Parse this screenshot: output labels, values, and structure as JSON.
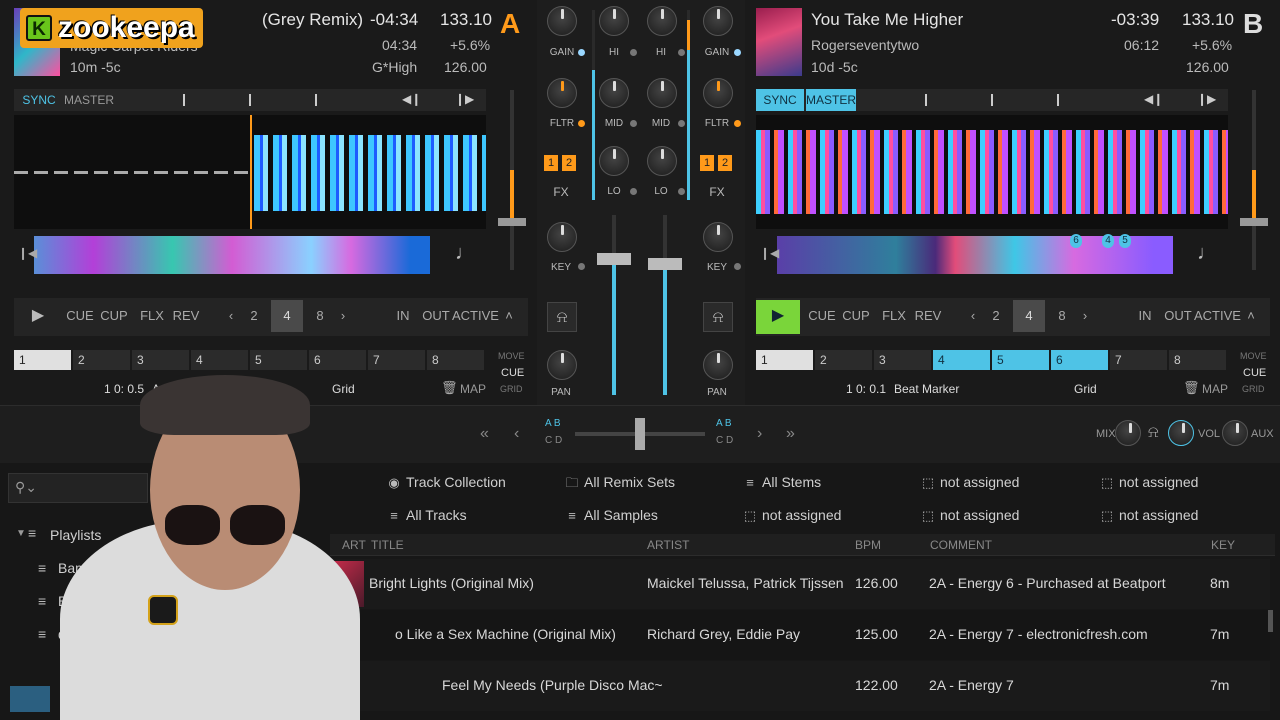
{
  "overlay": {
    "brand_letter": "K",
    "brand_name": "zookeepa"
  },
  "deckA": {
    "letter": "A",
    "title": "(Grey Remix)",
    "artist": "Magic Carpet Riders",
    "time_remaining": "-04:34",
    "time_total": "04:34",
    "bpm": "133.10",
    "pitch": "+5.6%",
    "info": "10m -5c",
    "key": "G*High",
    "base_bpm": "126.00",
    "sync": "SYNC",
    "master": "MASTER",
    "transport": {
      "cue": "CUE",
      "cup": "CUP",
      "flx": "FLX",
      "rev": "REV",
      "in": "IN",
      "out": "OUT",
      "active": "ACTIVE"
    },
    "loop_sizes": [
      "2",
      "4",
      "8"
    ],
    "hotcues": [
      "1",
      "2",
      "3",
      "4",
      "5",
      "6",
      "7",
      "8"
    ],
    "move_label": "MOVE",
    "move_mode": "CUE",
    "grid_label": "GRID",
    "beat_pos": "1 0: 0.5",
    "grid_mode": "AutoGri",
    "grid": "Grid",
    "map": "MAP"
  },
  "deckB": {
    "letter": "B",
    "title": "You Take Me Higher",
    "artist": "Rogerseventytwo",
    "time_remaining": "-03:39",
    "time_total": "06:12",
    "bpm": "133.10",
    "pitch": "+5.6%",
    "info": "10d -5c",
    "base_bpm": "126.00",
    "sync": "SYNC",
    "master": "MASTER",
    "transport": {
      "cue": "CUE",
      "cup": "CUP",
      "flx": "FLX",
      "rev": "REV",
      "in": "IN",
      "out": "OUT",
      "active": "ACTIVE"
    },
    "loop_sizes": [
      "2",
      "4",
      "8"
    ],
    "hotcues": [
      "1",
      "2",
      "3",
      "4",
      "5",
      "6",
      "7",
      "8"
    ],
    "markers": [
      "6",
      "4",
      "5"
    ],
    "move_label": "MOVE",
    "move_mode": "CUE",
    "grid_label": "GRID",
    "beat_pos": "1 0: 0.1",
    "grid_mode": "Beat Marker",
    "grid": "Grid",
    "map": "MAP"
  },
  "mixer": {
    "gain": "GAIN",
    "hi": "HI",
    "mid": "MID",
    "lo": "LO",
    "fltr": "FLTR",
    "fx": "FX",
    "fx_buttons": [
      "1",
      "2"
    ],
    "key": "KEY",
    "pan": "PAN"
  },
  "crossfader": {
    "left": "A B",
    "left2": "C D",
    "right": "A B",
    "right2": "C D"
  },
  "master_section": {
    "mix": "MIX",
    "vol": "VOL",
    "aux": "AUX"
  },
  "browser": {
    "search_icon": "search-icon",
    "favorites": [
      {
        "icon": "collection",
        "label": "Track Collection"
      },
      {
        "icon": "folder",
        "label": "All Remix Sets"
      },
      {
        "icon": "list",
        "label": "All Stems"
      },
      {
        "icon": "empty",
        "label": "not assigned"
      },
      {
        "icon": "empty",
        "label": "not assigned"
      },
      {
        "icon": "list",
        "label": "All Tracks"
      },
      {
        "icon": "list",
        "label": "All Samples"
      },
      {
        "icon": "empty",
        "label": "not assigned"
      },
      {
        "icon": "empty",
        "label": "not assigned"
      },
      {
        "icon": "empty",
        "label": "not assigned"
      }
    ],
    "tree": {
      "playlists": "Playlists",
      "items": [
        "Bamboo Beach",
        "Batc",
        "de"
      ]
    },
    "columns": {
      "art": "ART",
      "title": "TITLE",
      "artist": "ARTIST",
      "bpm": "BPM",
      "comment": "COMMENT",
      "key": "KEY"
    },
    "rows": [
      {
        "title": "Bright Lights (Original Mix)",
        "artist": "Maickel Telussa, Patrick Tijssen",
        "bpm": "126.00",
        "comment": "2A - Energy 6 - Purchased at Beatport",
        "key": "8m"
      },
      {
        "title": "o Like a Sex Machine (Original Mix)",
        "artist": "Richard Grey, Eddie Pay",
        "bpm": "125.00",
        "comment": "2A - Energy 7 - electronicfresh.com",
        "key": "7m"
      },
      {
        "title": "Feel My Needs (Purple Disco Mac~",
        "artist": "",
        "bpm": "122.00",
        "comment": "2A - Energy 7",
        "key": "7m"
      }
    ]
  },
  "colors": {
    "accent_blue": "#4ec3e6",
    "play_green": "#7ad53a",
    "deck_orange": "#ff9a1a"
  }
}
